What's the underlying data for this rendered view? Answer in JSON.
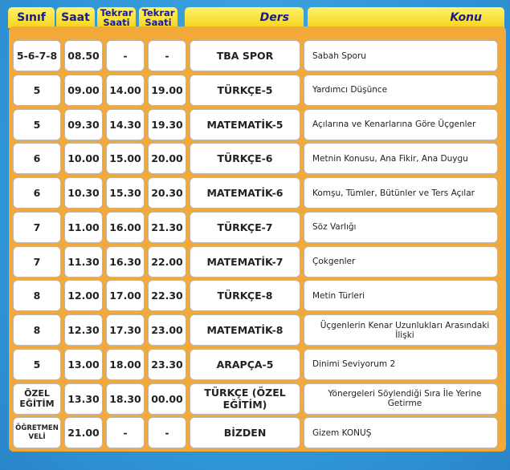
{
  "headers": {
    "sinif": "Sınıf",
    "saat": "Saat",
    "tekrar1": "Tekrar Saati",
    "tekrar2": "Tekrar Saati",
    "ders": "Ders",
    "konu": "Konu"
  },
  "rows": [
    {
      "sinif": "5-6-7-8",
      "saat": "08.50",
      "t1": "-",
      "t2": "-",
      "ders": "TBA SPOR",
      "konu": "Sabah Sporu"
    },
    {
      "sinif": "5",
      "saat": "09.00",
      "t1": "14.00",
      "t2": "19.00",
      "ders": "TÜRKÇE-5",
      "konu": "Yardımcı Düşünce"
    },
    {
      "sinif": "5",
      "saat": "09.30",
      "t1": "14.30",
      "t2": "19.30",
      "ders": "MATEMATİK-5",
      "konu": "Açılarına ve Kenarlarına Göre Üçgenler"
    },
    {
      "sinif": "6",
      "saat": "10.00",
      "t1": "15.00",
      "t2": "20.00",
      "ders": "TÜRKÇE-6",
      "konu": "Metnin Konusu, Ana Fikir, Ana Duygu"
    },
    {
      "sinif": "6",
      "saat": "10.30",
      "t1": "15.30",
      "t2": "20.30",
      "ders": "MATEMATİK-6",
      "konu": "Komşu, Tümler, Bütünler ve Ters Açılar"
    },
    {
      "sinif": "7",
      "saat": "11.00",
      "t1": "16.00",
      "t2": "21.30",
      "ders": "TÜRKÇE-7",
      "konu": "Söz Varlığı"
    },
    {
      "sinif": "7",
      "saat": "11.30",
      "t1": "16.30",
      "t2": "22.00",
      "ders": "MATEMATİK-7",
      "konu": "Çokgenler"
    },
    {
      "sinif": "8",
      "saat": "12.00",
      "t1": "17.00",
      "t2": "22.30",
      "ders": "TÜRKÇE-8",
      "konu": "Metin Türleri"
    },
    {
      "sinif": "8",
      "saat": "12.30",
      "t1": "17.30",
      "t2": "23.00",
      "ders": "MATEMATİK-8",
      "konu": "Üçgenlerin Kenar Uzunlukları Arasındaki İlişki"
    },
    {
      "sinif": "5",
      "saat": "13.00",
      "t1": "18.00",
      "t2": "23.30",
      "ders": "ARAPÇA-5",
      "konu": "Dinimi Seviyorum 2"
    },
    {
      "sinif": "ÖZEL EĞİTİM",
      "saat": "13.30",
      "t1": "18.30",
      "t2": "00.00",
      "ders": "TÜRKÇE (ÖZEL EĞİTİM)",
      "konu": "Yönergeleri Söylendiği Sıra İle Yerine Getirme"
    },
    {
      "sinif": "ÖĞRETMEN VELİ",
      "saat": "21.00",
      "t1": "-",
      "t2": "-",
      "ders": "BİZDEN",
      "konu": "Gizem KONUŞ"
    }
  ]
}
